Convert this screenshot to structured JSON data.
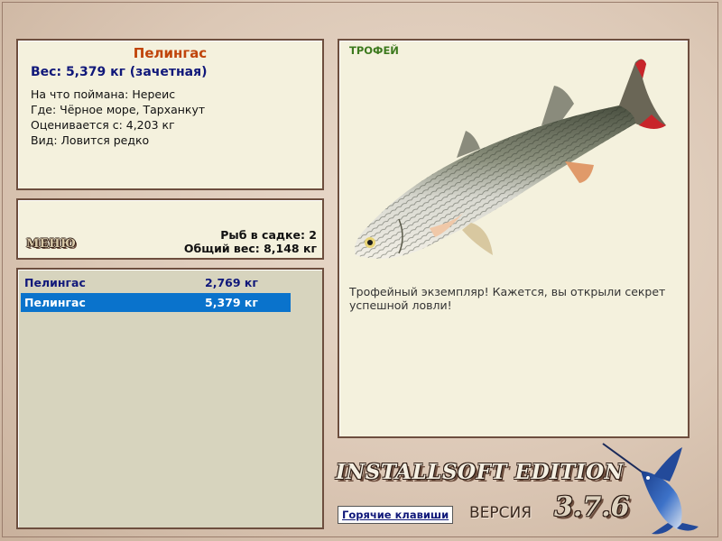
{
  "info": {
    "fish_name": "Пелингас",
    "weight_line": "Вес: 5,379 кг (зачетная)",
    "bait_line": "На что поймана: Нереис",
    "location_line": "Где: Чёрное море, Тарханкут",
    "rated_from_line": "Оценивается с: 4,203 кг",
    "rarity_line": "Вид: Ловится редко"
  },
  "cage": {
    "menu_label": "МЕНЮ",
    "fish_count_line": "Рыб в садке: 2",
    "total_weight_line": "Общий вес: 8,148 кг"
  },
  "catch_list": [
    {
      "name": "Пелингас",
      "weight": "2,769 кг",
      "selected": false
    },
    {
      "name": "Пелингас",
      "weight": "5,379 кг",
      "selected": true
    }
  ],
  "trophy": {
    "label": "ТРОФЕЙ",
    "message": "Трофейный экземпляр! Кажется, вы открыли секрет успешной ловли!"
  },
  "footer": {
    "edition": "INSTALLSOFT EDITION",
    "hotkeys_label": "Горячие клавиши",
    "version_label": "ВЕРСИЯ",
    "version_number": "3.7.6"
  },
  "colors": {
    "fish_title": "#c0440a",
    "weight_text": "#10187a",
    "selected_row": "#0a73cc",
    "trophy_label": "#3d7a1e",
    "panel_bg": "#f4f1dd"
  },
  "icons": {
    "trophy_image": "mullet-fish-icon",
    "logo_image": "marlin-logo-icon"
  }
}
